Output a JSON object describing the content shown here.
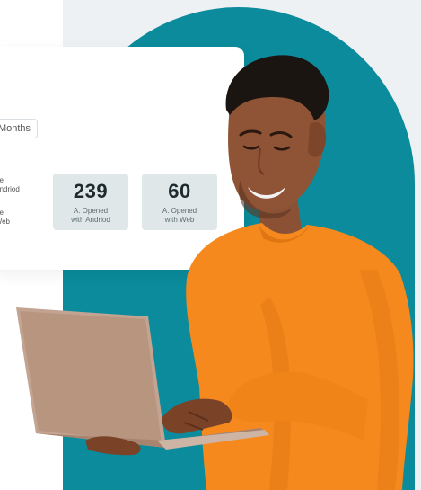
{
  "card": {
    "filter_button": "Months",
    "legend": [
      {
        "line1": "/Site",
        "line2": "d Andriod"
      },
      {
        "line1": "/Site",
        "line2": "d Web"
      }
    ],
    "stats": [
      {
        "value": "239",
        "label_line1": "A. Opened",
        "label_line2": "with Andriod"
      },
      {
        "value": "60",
        "label_line1": "A. Opened",
        "label_line2": "with Web"
      }
    ]
  },
  "colors": {
    "teal": "#0b8b9b",
    "sweater": "#f5891e",
    "stat_bg": "#dfe7e8",
    "laptop": "#c3a391"
  }
}
